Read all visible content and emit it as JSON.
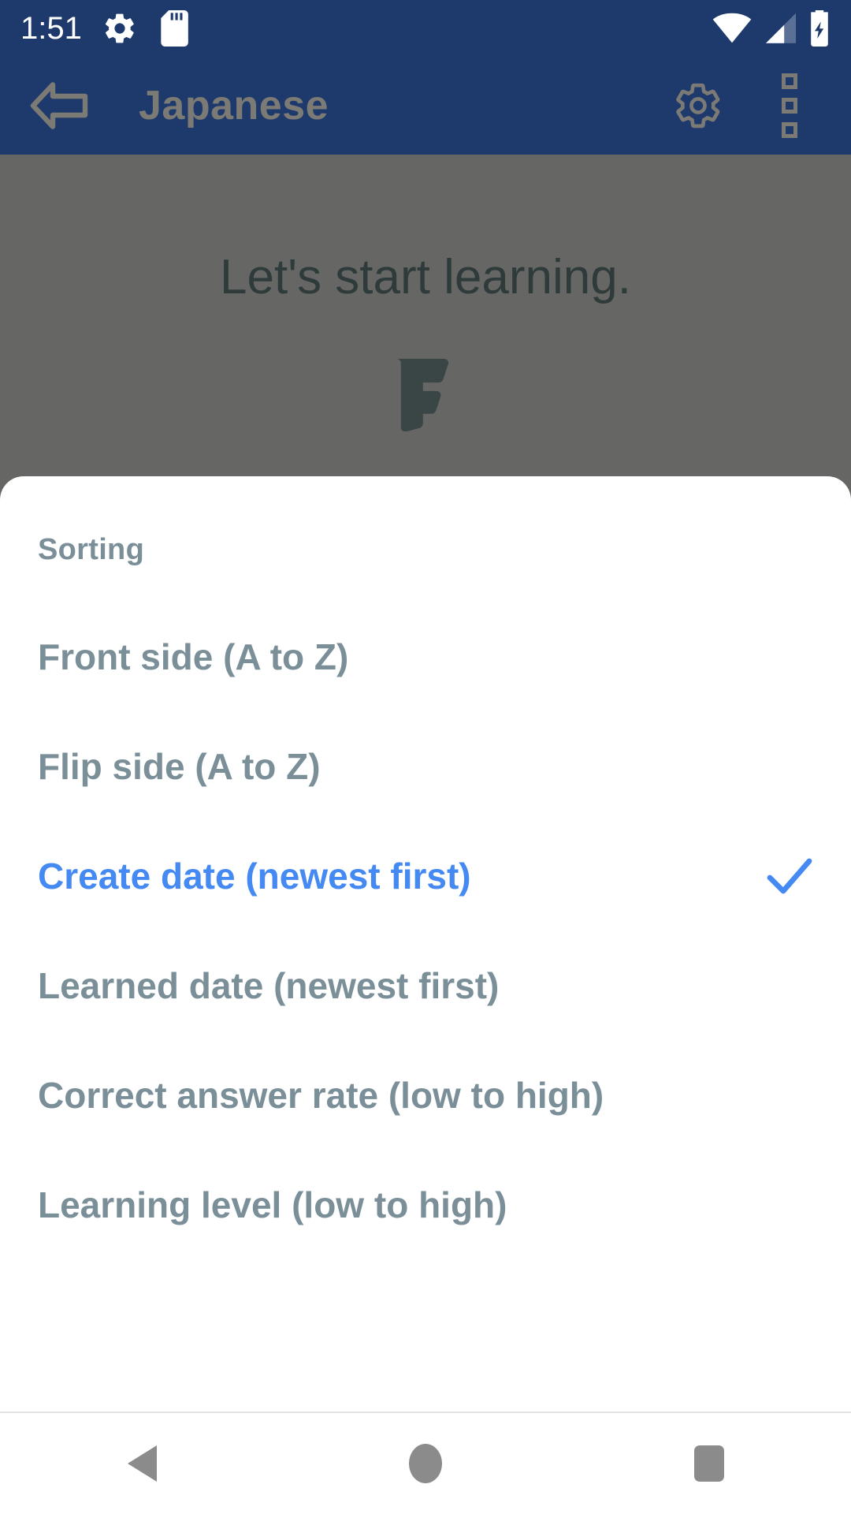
{
  "status_bar": {
    "clock": "1:51",
    "left_icons": [
      "gear-icon",
      "sd-card-icon"
    ],
    "right_icons": [
      "wifi-icon",
      "cellular-signal-icon",
      "battery-charging-icon"
    ],
    "background_color": "#1e3a6d",
    "foreground_color": "#ffffff"
  },
  "app_bar": {
    "title": "Japanese",
    "back_icon": "back-arrow-icon",
    "settings_icon": "gear-icon",
    "overflow_icon": "overflow-menu-icon",
    "background_color": "#1e3a6d",
    "dimmed_foreground_color": "#7c7a74"
  },
  "content": {
    "empty_state_text": "Let's start learning.",
    "logo_icon": "flashcards-f-logo",
    "scrim_color": "#666765",
    "text_color": "#2f3b3b"
  },
  "bottom_sheet": {
    "title": "Sorting",
    "title_color": "#7b8f99",
    "background_color": "#ffffff",
    "selected_color": "#4589f2",
    "option_color": "#7b8f99",
    "selected_index": 2,
    "options": [
      {
        "label": "Front side (A to Z)",
        "selected": false
      },
      {
        "label": "Flip side (A to Z)",
        "selected": false
      },
      {
        "label": "Create date (newest first)",
        "selected": true
      },
      {
        "label": "Learned date (newest first)",
        "selected": false
      },
      {
        "label": "Correct answer rate (low to high)",
        "selected": false
      },
      {
        "label": "Learning level (low to high)",
        "selected": false
      }
    ],
    "check_icon": "check-icon"
  },
  "nav_bar": {
    "background_color": "#ffffff",
    "icon_color": "#8b8b8b",
    "buttons": [
      {
        "name": "back-nav-button",
        "icon": "triangle-back-icon"
      },
      {
        "name": "home-nav-button",
        "icon": "circle-home-icon"
      },
      {
        "name": "recents-nav-button",
        "icon": "square-recents-icon"
      }
    ]
  }
}
